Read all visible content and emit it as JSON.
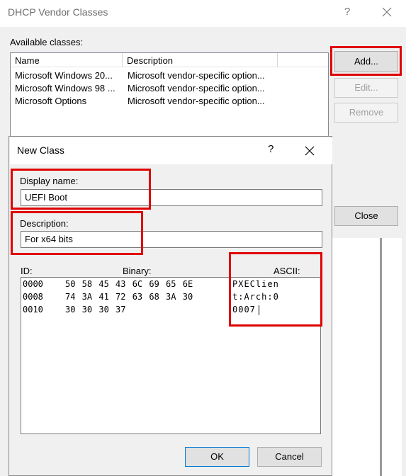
{
  "parent_dialog": {
    "title": "DHCP Vendor Classes",
    "help_glyph": "?",
    "available_label": "Available classes:",
    "columns": [
      "Name",
      "Description"
    ],
    "rows": [
      {
        "name": "Microsoft Windows 20...",
        "description": "Microsoft vendor-specific option..."
      },
      {
        "name": "Microsoft Windows 98 ...",
        "description": "Microsoft vendor-specific option..."
      },
      {
        "name": "Microsoft Options",
        "description": "Microsoft vendor-specific option..."
      }
    ],
    "buttons": {
      "add": "Add...",
      "edit": "Edit...",
      "remove": "Remove",
      "close": "Close"
    }
  },
  "new_class_dialog": {
    "title": "New Class",
    "help_glyph": "?",
    "display_name_label": "Display name:",
    "display_name_value": "UEFI Boot",
    "description_label": "Description:",
    "description_value": "For x64 bits",
    "id_label": "ID:",
    "binary_label": "Binary:",
    "ascii_label": "ASCII:",
    "hex_rows": [
      {
        "id": "0000",
        "bytes": "50 58 45 43 6C 69 65 6E",
        "ascii": "PXEClien"
      },
      {
        "id": "0008",
        "bytes": "74 3A 41 72 63 68 3A 30",
        "ascii": "t:Arch:0"
      },
      {
        "id": "0010",
        "bytes": "30 30 30 37",
        "ascii": "0007"
      }
    ],
    "buttons": {
      "ok": "OK",
      "cancel": "Cancel"
    }
  },
  "icons": {
    "close": "close-icon",
    "cursor": "text-cursor"
  },
  "colors": {
    "highlight": "#e00000"
  }
}
